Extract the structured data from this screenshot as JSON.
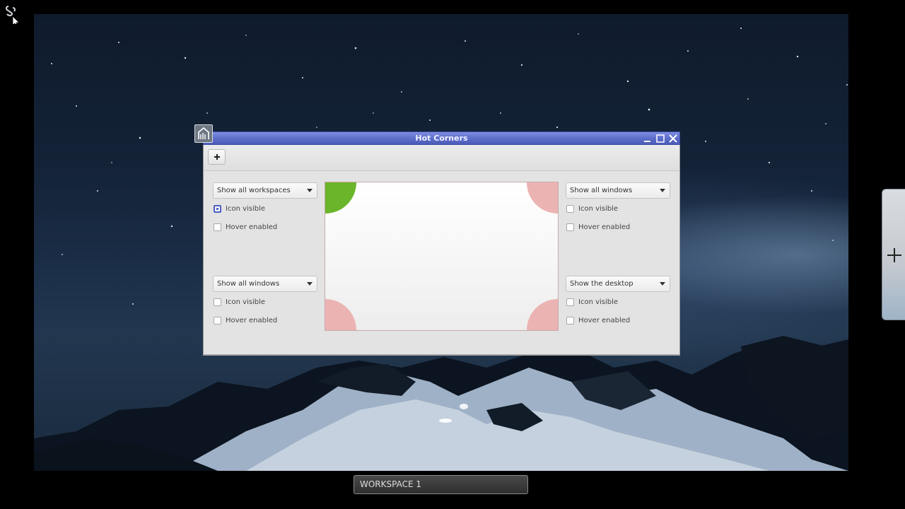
{
  "window": {
    "title": "Hot Corners"
  },
  "corners": {
    "top_left": {
      "action": "Show all workspaces",
      "icon_visible": {
        "label": "Icon visible",
        "checked": true
      },
      "hover_enabled": {
        "label": "Hover enabled",
        "checked": false
      }
    },
    "top_right": {
      "action": "Show all windows",
      "icon_visible": {
        "label": "Icon visible",
        "checked": false
      },
      "hover_enabled": {
        "label": "Hover enabled",
        "checked": false
      }
    },
    "bottom_left": {
      "action": "Show all windows",
      "icon_visible": {
        "label": "Icon visible",
        "checked": false
      },
      "hover_enabled": {
        "label": "Hover enabled",
        "checked": false
      }
    },
    "bottom_right": {
      "action": "Show the desktop",
      "icon_visible": {
        "label": "Icon visible",
        "checked": false
      },
      "hover_enabled": {
        "label": "Hover enabled",
        "checked": false
      }
    }
  },
  "preview": {
    "active_color": "#6ab52a",
    "inactive_color": "#ecb3b3"
  },
  "workspace": {
    "label": "WORKSPACE 1"
  },
  "icons": {
    "corner": "hot-corner-icon",
    "window": "window-menu-icon",
    "add": "add-icon",
    "side_add": "add-workspace-icon"
  }
}
